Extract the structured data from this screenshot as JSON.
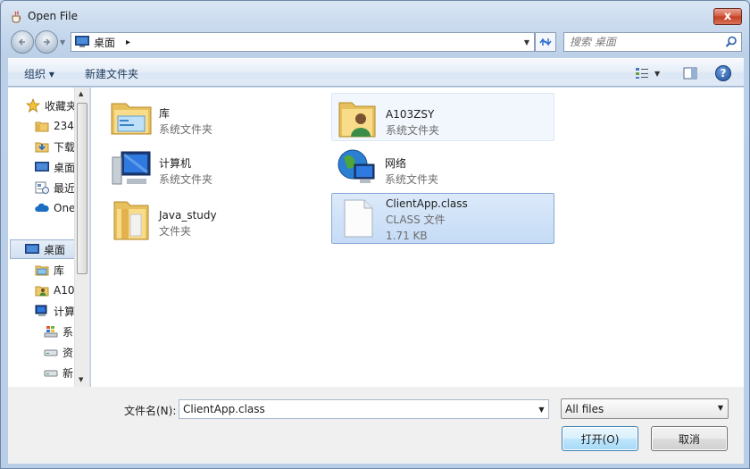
{
  "window": {
    "title": "Open File",
    "app_icon": "java-cup-icon",
    "close_label": "x"
  },
  "address": {
    "location": "桌面",
    "path_separator": "▸"
  },
  "search": {
    "placeholder": "搜索 桌面"
  },
  "toolbar": {
    "organize_label": "组织 ▾",
    "new_folder_label": "新建文件夹"
  },
  "nav_pane": {
    "items": [
      {
        "label": "收藏夹",
        "icon": "star-icon"
      },
      {
        "label": "234'",
        "icon": "folder-icon"
      },
      {
        "label": "下载",
        "icon": "downloads-folder-icon"
      },
      {
        "label": "桌面",
        "icon": "desktop-icon"
      },
      {
        "label": "最近",
        "icon": "recent-places-icon"
      },
      {
        "label": "One",
        "icon": "onedrive-icon"
      },
      {
        "label": "桌面",
        "icon": "desktop-icon",
        "selected": true
      },
      {
        "label": "库",
        "icon": "library-icon"
      },
      {
        "label": "A10",
        "icon": "user-folder-icon"
      },
      {
        "label": "计算",
        "icon": "computer-icon"
      },
      {
        "label": "系",
        "icon": "windows-drive-icon"
      },
      {
        "label": "资",
        "icon": "drive-icon"
      },
      {
        "label": "新",
        "icon": "drive-icon"
      }
    ]
  },
  "files": [
    {
      "name": "库",
      "sub1": "系统文件夹",
      "sub2": "",
      "icon": "library-icon"
    },
    {
      "name": "A103ZSY",
      "sub1": "系统文件夹",
      "sub2": "",
      "icon": "user-folder-icon"
    },
    {
      "name": "计算机",
      "sub1": "系统文件夹",
      "sub2": "",
      "icon": "computer-icon"
    },
    {
      "name": "网络",
      "sub1": "系统文件夹",
      "sub2": "",
      "icon": "network-icon"
    },
    {
      "name": "Java_study",
      "sub1": "文件夹",
      "sub2": "",
      "icon": "folder-icon"
    },
    {
      "name": "ClientApp.class",
      "sub1": "CLASS 文件",
      "sub2": "1.71 KB",
      "icon": "file-icon"
    }
  ],
  "footer": {
    "filename_label": "文件名(N):",
    "filename_value": "ClientApp.class",
    "filetype_value": "All files",
    "open_label": "打开(O)",
    "cancel_label": "取消"
  }
}
